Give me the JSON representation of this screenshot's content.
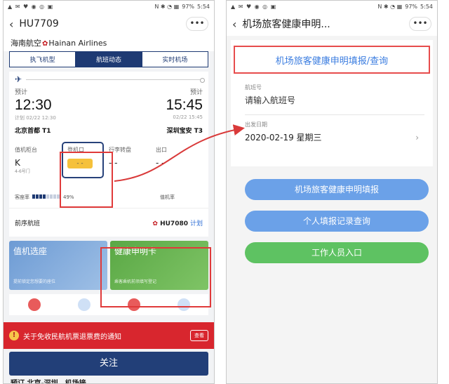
{
  "left_screen": {
    "status": {
      "icons": "▲ ✉ ♥ ◉ ◎ ▣",
      "battery": "97%",
      "time": "5:54",
      "sys": "N ✱ ◔ ▦"
    },
    "nav": {
      "back": "‹",
      "title": "HU7709",
      "more": "•••"
    },
    "airline": {
      "name_cn": "海南航空",
      "name_en": "Hainan Airlines"
    },
    "tabs": [
      "执飞机型",
      "航班动态",
      "实时机场"
    ],
    "flight": {
      "dep_label": "预计",
      "dep_time": "12:30",
      "dep_plan": "计划 02/22 12:30",
      "dep_station": "北京首都 T1",
      "arr_label": "预计",
      "arr_time": "15:45",
      "arr_plan": "02/22 15:45",
      "arr_station": "深圳宝安 T3",
      "checkin_label": "值机柜台",
      "checkin_value": "K",
      "checkin_sub": "4-6号门",
      "gate_label": "登机口",
      "gate_value": "- -",
      "baggage_label": "行李转盘",
      "baggage_value": "- -",
      "exit_label": "出口",
      "exit_value": "- -",
      "load_label": "客座率",
      "load_value": "49%",
      "load_fraction": 0.49,
      "checkin_rate_label": "值机率",
      "prev_label": "前序航班",
      "prev_flight": "HU7080",
      "prev_plan": "计划"
    },
    "promos": [
      {
        "title": "值机选座",
        "sub": "提前锁定您想要的座位"
      },
      {
        "title": "健康申明卡",
        "sub": "乘客乘机前须填写登记"
      }
    ],
    "notice": {
      "text": "关于免收民航机票退票费的通知",
      "view": "查看"
    },
    "follow": "关注",
    "bottom_text": "预订 北京-深圳，机场接"
  },
  "right_screen": {
    "status": {
      "icons": "▲ ✉ ♥ ◉ ◎ ▣",
      "battery": "97%",
      "time": "5:54",
      "sys": "N ✱ ◔ ▦"
    },
    "nav": {
      "back": "‹",
      "title": "机场旅客健康申明...",
      "more": "•••"
    },
    "form_title": "机场旅客健康申明填报/查询",
    "flight_no_label": "航班号",
    "flight_no_placeholder": "请输入航班号",
    "date_label": "出发日期",
    "date_value": "2020-02-19  星期三",
    "date_chevron": "›",
    "buttons": [
      "机场旅客健康申明填报",
      "个人填报记录查询",
      "工作人员入口"
    ]
  }
}
